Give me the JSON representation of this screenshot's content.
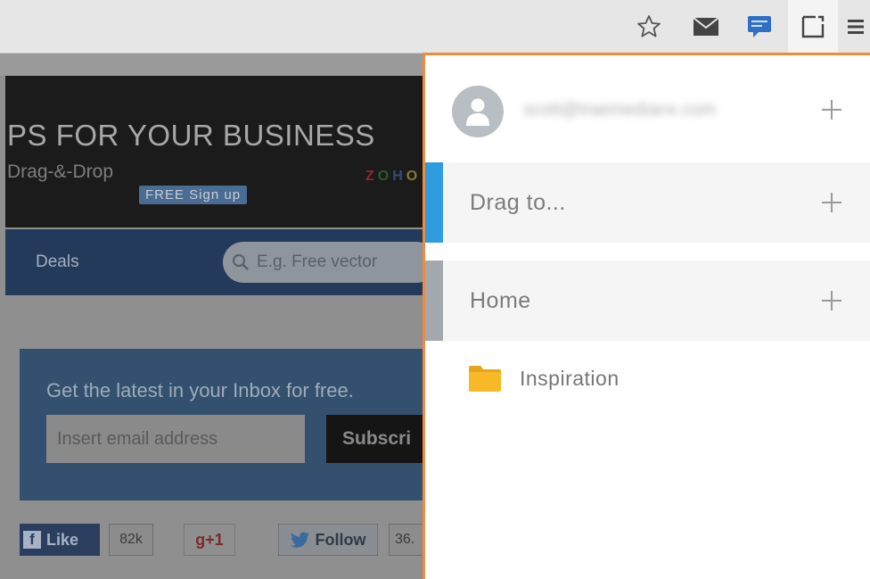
{
  "colors": {
    "accent_orange": "#f08a3c",
    "drag_bar_blue": "#2e9cdf",
    "home_bar_gray": "#a2a8ad",
    "folder_yellow": "#f7b928"
  },
  "toolbar": {
    "icons": [
      "star-icon",
      "mail-icon",
      "chat-icon",
      "extension-icon",
      "menu-icon"
    ]
  },
  "page": {
    "banner": {
      "headline": "PS FOR YOUR BUSINESS",
      "sub": "Drag-&-Drop",
      "signup": "FREE Sign up",
      "logo": "ZOHO"
    },
    "nav": {
      "deals": "Deals",
      "search_placeholder": "E.g. Free vector"
    },
    "newsletter": {
      "title": "Get the latest in your Inbox for free.",
      "input_placeholder": "Insert email address",
      "button": "Subscri"
    },
    "social": {
      "like": "Like",
      "like_count": "82k",
      "gplus": "+1",
      "follow": "Follow",
      "follow_count": "36."
    }
  },
  "popup": {
    "account": {
      "email": "scott@traemedianx.com"
    },
    "rows": [
      {
        "label": "Drag to..."
      },
      {
        "label": "Home"
      }
    ],
    "folders": [
      {
        "label": "Inspiration"
      }
    ]
  }
}
